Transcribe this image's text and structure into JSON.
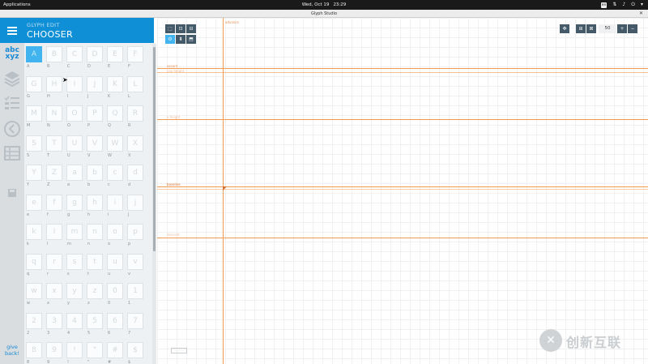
{
  "topbar": {
    "activities": "Applications",
    "date": "Wed, Oct 19",
    "time": "23:29",
    "keyboard": "en"
  },
  "window": {
    "title": "Glyph Studio",
    "close_label": "✕"
  },
  "nav": {
    "abc_line1": "abc",
    "abc_line2": "xyz",
    "give_back_line1": "give",
    "give_back_line2": "back!"
  },
  "panel": {
    "subtitle": "GLYPH EDIT",
    "title": "CHOOSER",
    "selected": "A",
    "glyphs": [
      "A",
      "B",
      "C",
      "D",
      "E",
      "F",
      "G",
      "H",
      "I",
      "J",
      "K",
      "L",
      "M",
      "N",
      "O",
      "P",
      "Q",
      "R",
      "S",
      "T",
      "U",
      "V",
      "W",
      "X",
      "Y",
      "Z",
      "a",
      "b",
      "c",
      "d",
      "e",
      "f",
      "g",
      "h",
      "i",
      "j",
      "k",
      "l",
      "m",
      "n",
      "o",
      "p",
      "q",
      "r",
      "s",
      "t",
      "u",
      "v",
      "w",
      "x",
      "y",
      "z",
      "0",
      "1",
      "2",
      "3",
      "4",
      "5",
      "6",
      "7",
      "8",
      "9",
      "!",
      "\"",
      "#",
      "$"
    ]
  },
  "canvas": {
    "guides": {
      "ascent": "ascent",
      "cap_height": "cap height",
      "x_height": "x height",
      "baseline": "baseline",
      "descent": "descent",
      "advance": "advance"
    },
    "zoom": "50",
    "tools_top": [
      "⬚",
      "⊡",
      "⊟"
    ],
    "tools_bottom": [
      "⚙",
      "⬍",
      "⬒"
    ],
    "view_buttons": [
      "✥",
      "⊞",
      "⊠"
    ],
    "zoom_in": "+",
    "zoom_out": "−",
    "info_box": "⋯ ⋯ ⋯"
  },
  "watermark": {
    "text": "创新互联",
    "mark": "✕"
  },
  "colors": {
    "accent": "#0e8fd6",
    "selected": "#41b4f0",
    "guide": "#f39a52"
  }
}
